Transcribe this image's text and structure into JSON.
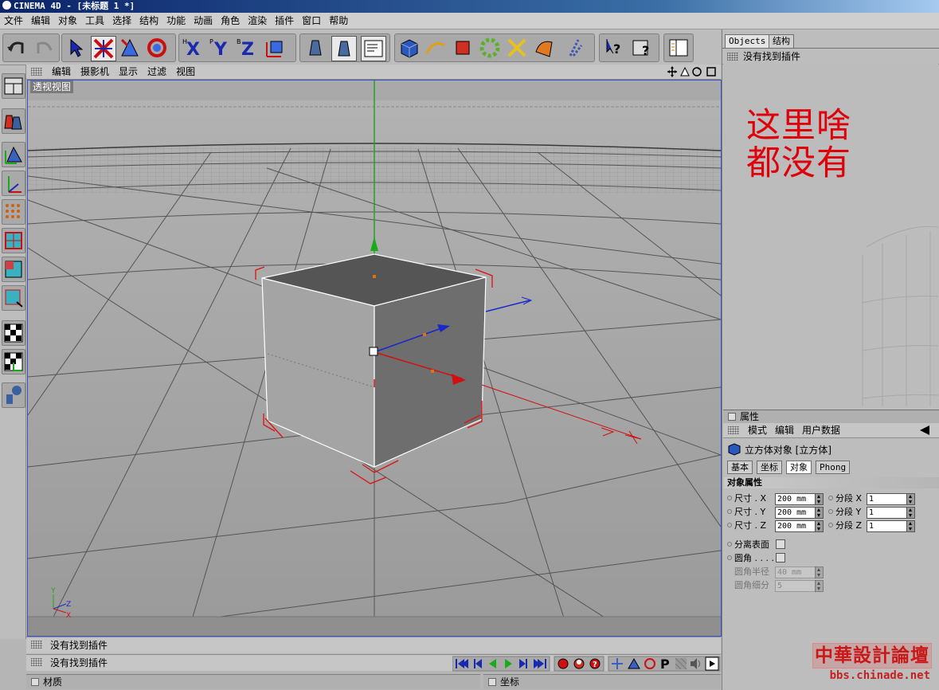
{
  "window": {
    "title": "CINEMA 4D - [未标题 1 *]"
  },
  "menu": [
    "文件",
    "编辑",
    "对象",
    "工具",
    "选择",
    "结构",
    "功能",
    "动画",
    "角色",
    "渲染",
    "插件",
    "窗口",
    "帮助"
  ],
  "viewport": {
    "menu": [
      "编辑",
      "摄影机",
      "显示",
      "过滤",
      "视图"
    ],
    "label": "透视视图",
    "axis_labels": {
      "y": "Y",
      "z": "Z",
      "x": "X"
    }
  },
  "status": {
    "line1": "没有找到插件",
    "line2": "没有找到插件"
  },
  "bottom": {
    "materials": "材质",
    "coordinates": "坐标"
  },
  "objects_panel": {
    "tabs": [
      "Objects",
      "结构"
    ],
    "status": "没有找到插件",
    "note": [
      "这里啥",
      "都没有"
    ]
  },
  "attributes": {
    "header": "属性",
    "menu": [
      "模式",
      "编辑",
      "用户数据"
    ],
    "object_title": "立方体对象 [立方体]",
    "tabs": [
      "基本",
      "坐标",
      "对象",
      "Phong"
    ],
    "active_tab": "对象",
    "section": "对象属性",
    "size_rows": [
      {
        "label": "尺寸 . X",
        "value": "200 mm",
        "seg_label": "分段 X",
        "seg_value": "1"
      },
      {
        "label": "尺寸 . Y",
        "value": "200 mm",
        "seg_label": "分段 Y",
        "seg_value": "1"
      },
      {
        "label": "尺寸 . Z",
        "value": "200 mm",
        "seg_label": "分段 Z",
        "seg_value": "1"
      }
    ],
    "separate_surfaces": "分离表面",
    "fillet": "圆角 . . . .",
    "fillet_radius_label": "圆角半径",
    "fillet_radius_value": "40 mm",
    "fillet_subdiv_label": "圆角细分",
    "fillet_subdiv_value": "5"
  },
  "watermark": {
    "line1": "中華設計論壇",
    "line2": "bbs.chinade.net"
  },
  "colors": {
    "accent_red": "#e0000a",
    "axis_green": "#1aaa1a",
    "axis_blue": "#1a28c8",
    "axis_red": "#d01010",
    "viewport_border": "#3a52c8"
  }
}
